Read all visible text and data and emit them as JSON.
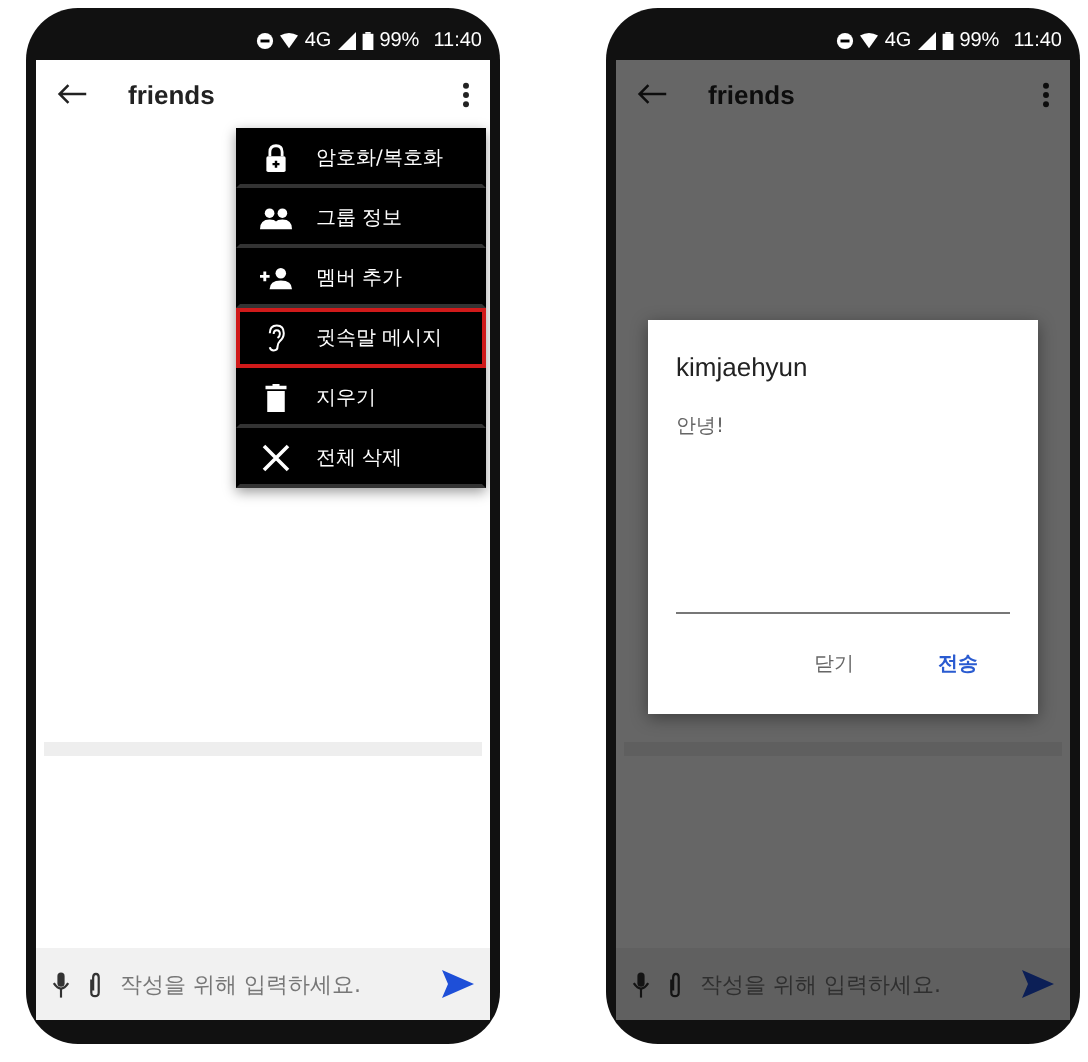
{
  "phones": [
    {
      "status_bar": {
        "network": "4G",
        "battery": "99%",
        "time": "11:40"
      },
      "app_bar": {
        "title": "friends"
      },
      "dimmed": false,
      "menu": [
        {
          "label": "암호화/복호화",
          "highlighted": false
        },
        {
          "label": "그룹 정보",
          "highlighted": false
        },
        {
          "label": "멤버 추가",
          "highlighted": false
        },
        {
          "label": "귓속말 메시지",
          "highlighted": true
        },
        {
          "label": "지우기",
          "highlighted": false
        },
        {
          "label": "전체 삭제",
          "highlighted": false
        }
      ],
      "composer": {
        "placeholder": "작성을 위해 입력하세요."
      }
    },
    {
      "status_bar": {
        "network": "4G",
        "battery": "99%",
        "time": "11:40"
      },
      "app_bar": {
        "title": "friends"
      },
      "dimmed": true,
      "dialog": {
        "title": "kimjaehyun",
        "value": "안녕!",
        "buttons": [
          {
            "label": "닫기",
            "primary": false
          },
          {
            "label": "전송",
            "primary": true
          }
        ]
      },
      "composer": {
        "placeholder": "작성을 위해 입력하세요."
      }
    }
  ]
}
